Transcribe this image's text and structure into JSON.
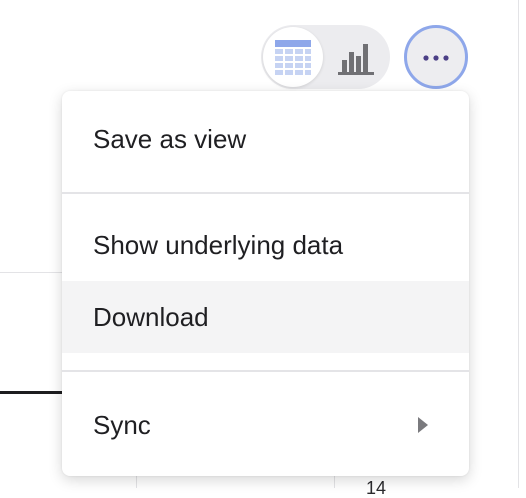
{
  "background": {
    "cell_value": "14"
  },
  "view_toggle": {
    "table_icon": "table-icon",
    "chart_icon": "bar-chart-icon",
    "selected": "table"
  },
  "more_button": {
    "icon": "more-horizontal-icon"
  },
  "menu": {
    "items": [
      {
        "label": "Save as view"
      },
      {
        "label": "Show underlying data"
      },
      {
        "label": "Download"
      },
      {
        "label": "Sync",
        "submenu_icon": "caret-right-icon"
      }
    ],
    "highlighted": "Download"
  },
  "colors": {
    "accent": "#8ea7ea",
    "table_icon": "#a8bbee",
    "menu_hover": "#f4f4f5",
    "text": "#1f1f22"
  }
}
